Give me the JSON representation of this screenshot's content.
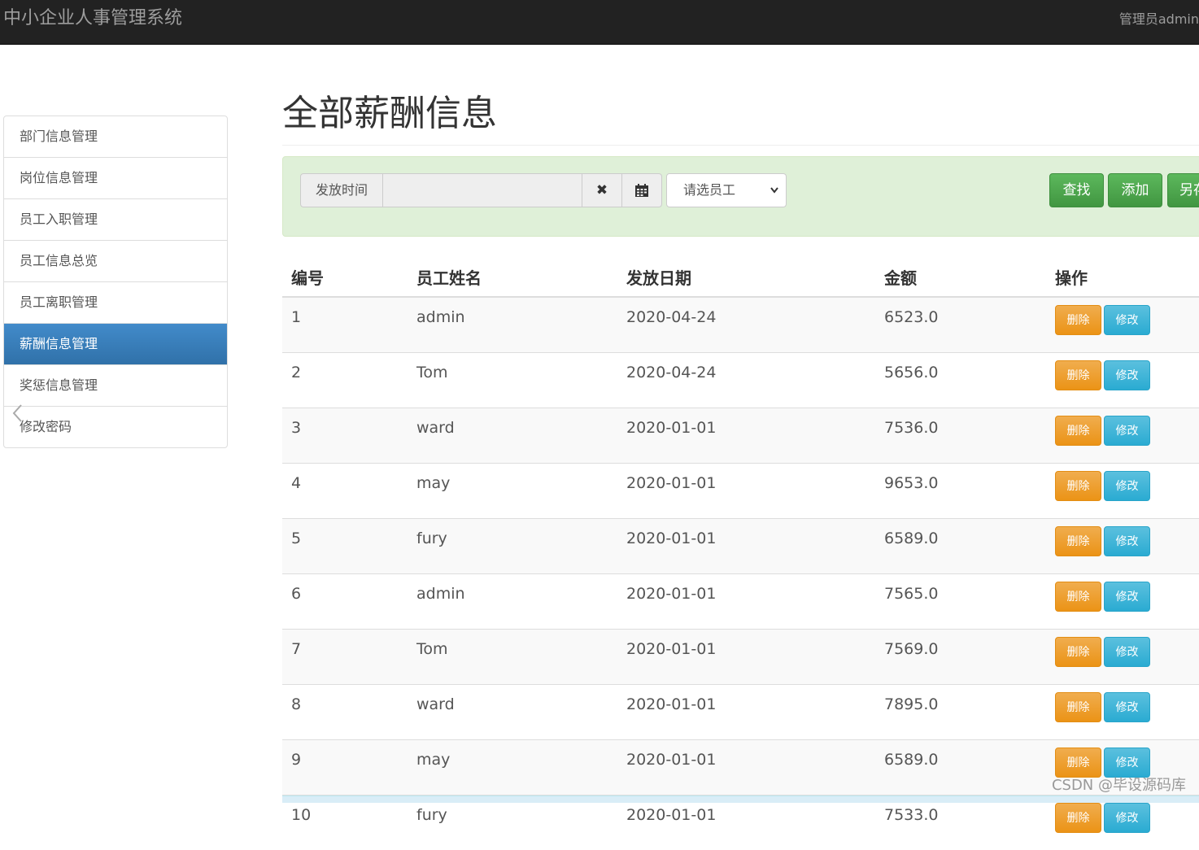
{
  "navbar": {
    "brand": "中小企业人事管理系统",
    "user": "管理员admin"
  },
  "sidebar": {
    "items": [
      {
        "label": "部门信息管理"
      },
      {
        "label": "岗位信息管理"
      },
      {
        "label": "员工入职管理"
      },
      {
        "label": "员工信息总览"
      },
      {
        "label": "员工离职管理"
      },
      {
        "label": "薪酬信息管理",
        "active": true
      },
      {
        "label": "奖惩信息管理"
      },
      {
        "label": "修改密码"
      }
    ]
  },
  "main": {
    "title": "全部薪酬信息",
    "search": {
      "date_label": "发放时间",
      "date_value": "",
      "clear_icon": "✖",
      "calendar_icon": "calendar-icon",
      "employee_select": "请选员工",
      "find_label": "查找",
      "add_label": "添加",
      "other_label": "另存"
    },
    "table": {
      "headers": [
        "编号",
        "员工姓名",
        "发放日期",
        "金额",
        "操作"
      ],
      "rows": [
        {
          "id": "1",
          "name": "admin",
          "date": "2020-04-24",
          "amount": "6523.0"
        },
        {
          "id": "2",
          "name": "Tom",
          "date": "2020-04-24",
          "amount": "5656.0"
        },
        {
          "id": "3",
          "name": "ward",
          "date": "2020-01-01",
          "amount": "7536.0"
        },
        {
          "id": "4",
          "name": "may",
          "date": "2020-01-01",
          "amount": "9653.0"
        },
        {
          "id": "5",
          "name": "fury",
          "date": "2020-01-01",
          "amount": "6589.0"
        },
        {
          "id": "6",
          "name": "admin",
          "date": "2020-01-01",
          "amount": "7565.0"
        },
        {
          "id": "7",
          "name": "Tom",
          "date": "2020-01-01",
          "amount": "7569.0"
        },
        {
          "id": "8",
          "name": "ward",
          "date": "2020-01-01",
          "amount": "7895.0"
        },
        {
          "id": "9",
          "name": "may",
          "date": "2020-01-01",
          "amount": "6589.0"
        },
        {
          "id": "10",
          "name": "fury",
          "date": "2020-01-01",
          "amount": "7533.0"
        }
      ],
      "delete_label": "删除",
      "edit_label": "修改"
    }
  },
  "watermark": "CSDN @毕设源码库",
  "colors": {
    "navbar_bg": "#222222",
    "active_item": "#337ab7",
    "search_panel_bg": "#dff0d8",
    "success": "#5cb85c",
    "warning": "#f0ad4e",
    "info": "#5bc0de"
  }
}
